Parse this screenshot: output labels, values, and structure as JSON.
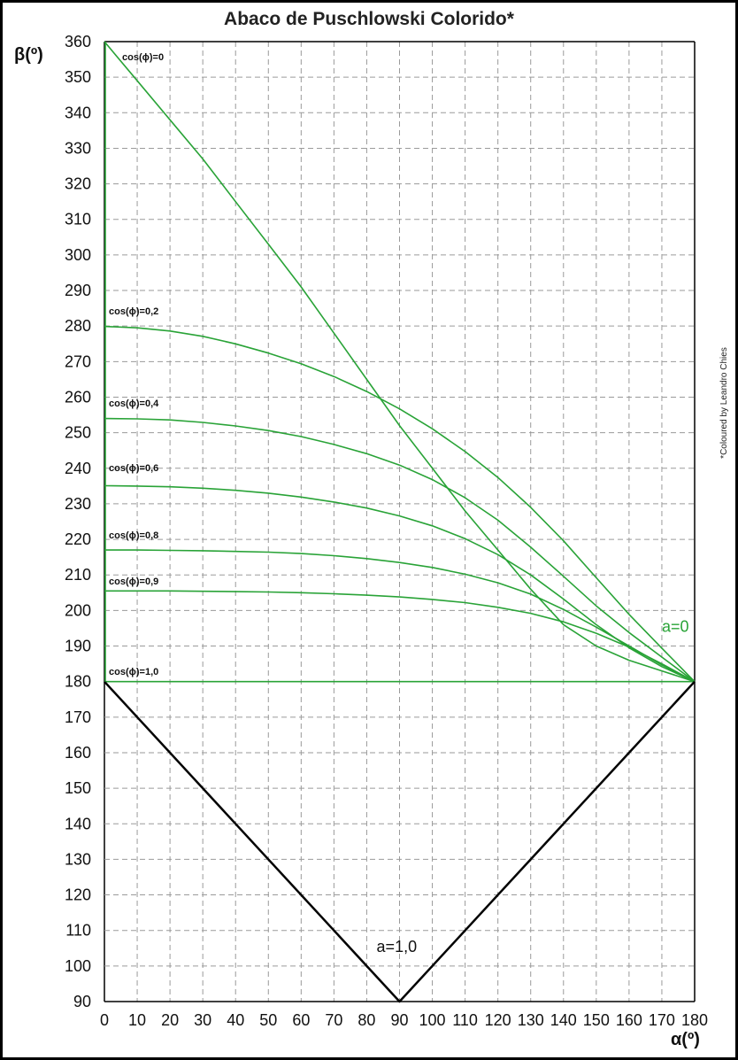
{
  "chart_data": {
    "type": "line",
    "title": "Abaco de Puschlowski Colorido*",
    "xlabel": "α(º)",
    "ylabel": "β(º)",
    "xlim": [
      0,
      180
    ],
    "ylim": [
      90,
      360
    ],
    "x_ticks": [
      "0",
      "10",
      "20",
      "30",
      "40",
      "50",
      "60",
      "70",
      "80",
      "90",
      "100",
      "110",
      "120",
      "130",
      "140",
      "150",
      "160",
      "170",
      "180"
    ],
    "y_ticks": [
      "90",
      "100",
      "110",
      "120",
      "130",
      "140",
      "150",
      "160",
      "170",
      "180",
      "190",
      "200",
      "210",
      "220",
      "230",
      "240",
      "250",
      "260",
      "270",
      "280",
      "290",
      "300",
      "310",
      "320",
      "330",
      "340",
      "350",
      "360"
    ],
    "grid": true,
    "credit": "*Coloured by Leandro Chies",
    "colors": {
      "green": "#29a337",
      "black": "#000000",
      "grid": "#9a9a9a"
    },
    "series": [
      {
        "name": "cos(ϕ)=0",
        "color": "#29a337",
        "x": [
          0,
          10,
          20,
          30,
          40,
          50,
          60,
          70,
          80,
          90,
          100,
          110,
          120,
          130,
          140,
          150,
          160,
          170,
          180
        ],
        "y": [
          360,
          349,
          338,
          327,
          315,
          303,
          291,
          278,
          265,
          252,
          240,
          228,
          217,
          206,
          196,
          190,
          186,
          183,
          180
        ]
      },
      {
        "name": "cos(ϕ)=0,2",
        "color": "#29a337",
        "x": [
          0,
          10,
          20,
          30,
          40,
          50,
          60,
          70,
          80,
          90,
          100,
          110,
          120,
          130,
          140,
          150,
          160,
          170,
          180
        ],
        "y": [
          279.9,
          279.5,
          278.6,
          277.1,
          275,
          272.4,
          269.4,
          265.8,
          261.6,
          256.7,
          251.1,
          244.7,
          237.4,
          229,
          219.6,
          209.2,
          198.9,
          189.4,
          180
        ]
      },
      {
        "name": "cos(ϕ)=0,4",
        "color": "#29a337",
        "x": [
          0,
          10,
          20,
          30,
          40,
          50,
          60,
          70,
          80,
          90,
          100,
          110,
          120,
          130,
          140,
          150,
          160,
          170,
          180
        ],
        "y": [
          254,
          253.9,
          253.6,
          252.9,
          251.9,
          250.6,
          248.9,
          246.7,
          244.1,
          240.9,
          236.8,
          231.7,
          225.4,
          217.8,
          209.6,
          201.3,
          193.8,
          186.9,
          180
        ]
      },
      {
        "name": "cos(ϕ)=0,6",
        "color": "#29a337",
        "x": [
          0,
          10,
          20,
          30,
          40,
          50,
          60,
          70,
          80,
          90,
          100,
          110,
          120,
          130,
          140,
          150,
          160,
          170,
          180
        ],
        "y": [
          235.1,
          235,
          234.8,
          234.4,
          233.8,
          233,
          231.9,
          230.5,
          228.8,
          226.6,
          223.8,
          220.2,
          215.7,
          210,
          203.2,
          196,
          189.5,
          184.2,
          180
        ]
      },
      {
        "name": "cos(ϕ)=0,8",
        "color": "#29a337",
        "x": [
          0,
          10,
          20,
          30,
          40,
          50,
          60,
          70,
          80,
          90,
          100,
          110,
          120,
          130,
          140,
          150,
          160,
          170,
          180
        ],
        "y": [
          217,
          217,
          216.9,
          216.8,
          216.6,
          216.4,
          216,
          215.4,
          214.6,
          213.5,
          212.1,
          210.2,
          207.8,
          204.6,
          200.3,
          195.3,
          190,
          184.7,
          180
        ]
      },
      {
        "name": "cos(ϕ)=0,9",
        "color": "#29a337",
        "x": [
          0,
          10,
          20,
          30,
          40,
          50,
          60,
          70,
          80,
          90,
          100,
          110,
          120,
          130,
          140,
          150,
          160,
          170,
          180
        ],
        "y": [
          205.5,
          205.5,
          205.5,
          205.4,
          205.3,
          205.2,
          205,
          204.7,
          204.3,
          203.8,
          203.1,
          202.2,
          200.9,
          199.2,
          196.8,
          193.6,
          189.7,
          185,
          180
        ]
      },
      {
        "name": "cos(ϕ)=1,0",
        "color": "#29a337",
        "x": [
          0,
          180
        ],
        "y": [
          180,
          180
        ]
      },
      {
        "name": "",
        "color": "#000000",
        "x": [
          0,
          90,
          180
        ],
        "y": [
          180,
          90,
          180
        ]
      }
    ],
    "annotations": [
      {
        "text": "a=0",
        "x": 170,
        "y": 194,
        "color": "#29a337"
      },
      {
        "text": "a=1,0",
        "x": 83,
        "y": 104,
        "color": "#000000"
      }
    ]
  }
}
